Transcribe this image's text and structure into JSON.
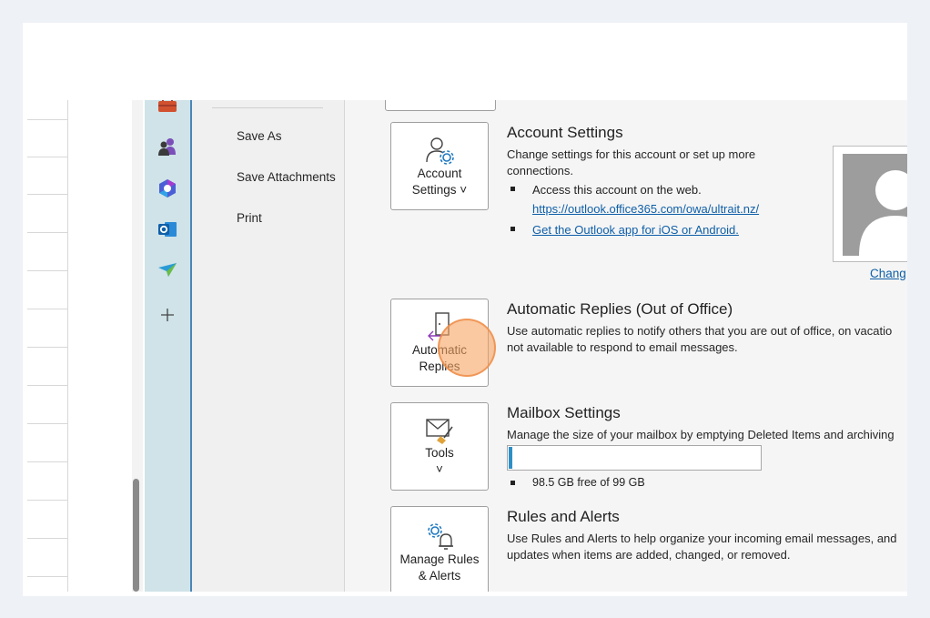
{
  "nav": {
    "items": [
      {
        "label": "Save As"
      },
      {
        "label": "Save Attachments"
      },
      {
        "label": "Print"
      }
    ]
  },
  "app_bar": {
    "icons": [
      "briefcase-icon",
      "people-icon",
      "copilot-icon",
      "outlook-icon",
      "paper-plane-icon",
      "plus-icon"
    ]
  },
  "account": {
    "button_line1": "Account",
    "button_line2": "Settings ˅",
    "title": "Account Settings",
    "desc_line1": "Change settings for this account or set up more",
    "desc_line2": "connections.",
    "bullet1": "Access this account on the web.",
    "link1": "https://outlook.office365.com/owa/ultrait.nz/",
    "link2": "Get the Outlook app for iOS or Android.",
    "change_label": "Chang"
  },
  "auto_replies": {
    "button_line1": "Automatic",
    "button_line2": "Replies",
    "title": "Automatic Replies (Out of Office)",
    "desc_line1": "Use automatic replies to notify others that you are out of office, on vacatio",
    "desc_line2": "not available to respond to email messages."
  },
  "mailbox": {
    "button_label": "Tools",
    "button_chevron": "˅",
    "title": "Mailbox Settings",
    "desc_line1": "Manage the size of your mailbox by emptying Deleted Items and archiving",
    "usage_fraction": 0.015,
    "free_text": "98.5 GB free of 99 GB"
  },
  "rules": {
    "button_line1": "Manage Rules",
    "button_line2": "& Alerts",
    "title": "Rules and Alerts",
    "desc_line1": "Use Rules and Alerts to help organize your incoming email messages, and",
    "desc_line2": "updates when items are added, changed, or removed."
  },
  "colors": {
    "accent": "#2e8fc7",
    "link": "#0f5fa8",
    "highlight": "#f6a462"
  }
}
